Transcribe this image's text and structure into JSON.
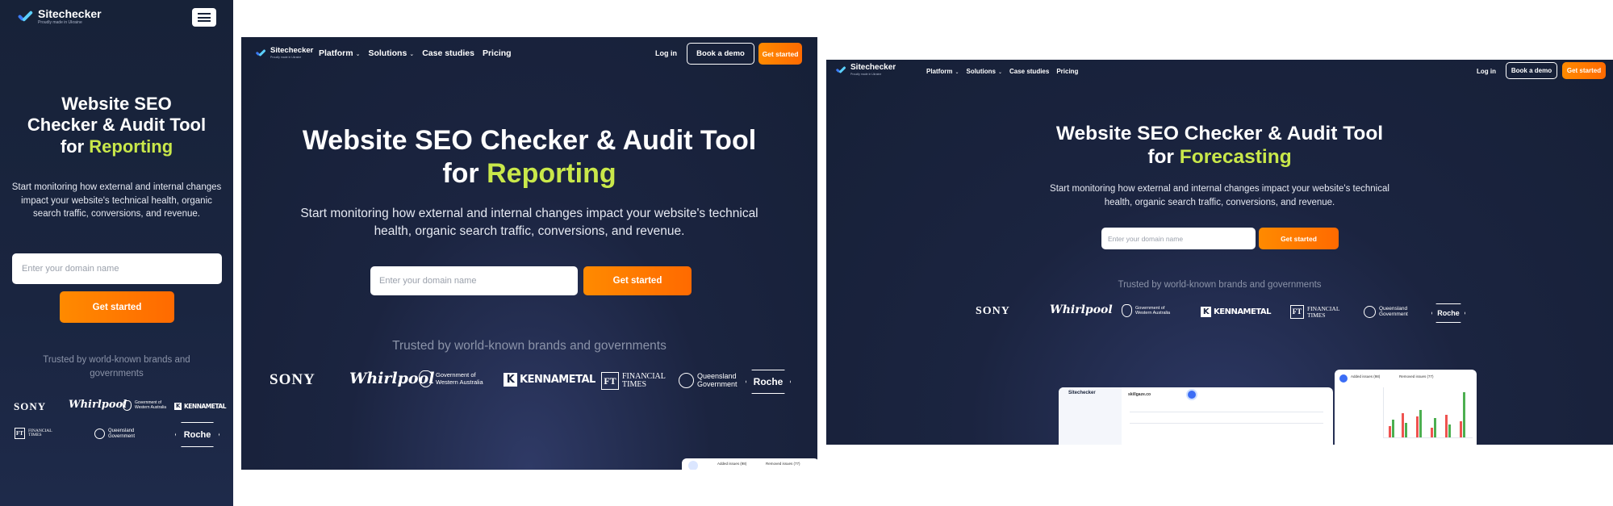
{
  "brand": {
    "name": "Sitechecker",
    "tagline": "Proudly made in Ukraine"
  },
  "colors": {
    "background": "#172238",
    "accent": "#ff7a00",
    "highlight": "#c9e84a",
    "text": "#ffffff"
  },
  "nav": {
    "platform": "Platform",
    "solutions": "Solutions",
    "case_studies": "Case studies",
    "pricing": "Pricing",
    "login": "Log in",
    "book_demo": "Book a demo",
    "get_started": "Get started"
  },
  "hero": {
    "title_prefix": "Website SEO Checker & Audit Tool",
    "title_for": "for",
    "highlight_reporting": "Reporting",
    "highlight_forecasting": "Forecasting",
    "subtitle": "Start monitoring how external and internal changes impact your website's technical health, organic search traffic, conversions, and revenue.",
    "mobile_title_line1": "Website SEO",
    "mobile_title_line2": "Checker & Audit Tool",
    "input_placeholder": "Enter your domain name",
    "cta": "Get started"
  },
  "trusted": {
    "text": "Trusted by world-known brands and governments"
  },
  "logos": {
    "sony": "SONY",
    "whirlpool": "Whirlpool",
    "gov_line1": "Government of",
    "gov_line2": "Western Australia",
    "kennametal": "KENNAMETAL",
    "ft_line1": "FINANCIAL",
    "ft_line2": "TIMES",
    "queensland_line1": "Queensland",
    "queensland_line2": "Government",
    "roche": "Roche"
  },
  "dashboard": {
    "site": "skillgaze.co",
    "issues_a": "Added issues (98)",
    "issues_b": "Removed issues (77)"
  }
}
